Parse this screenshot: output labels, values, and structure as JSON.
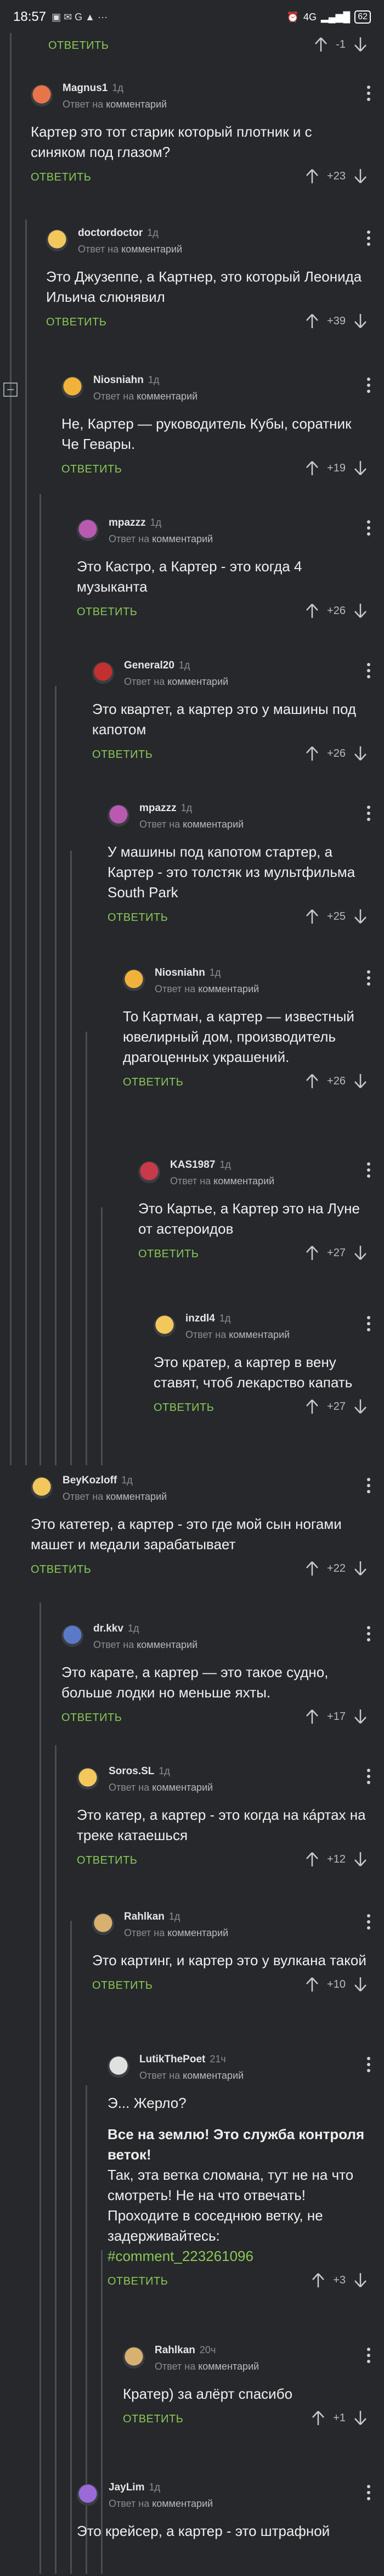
{
  "status_bar": {
    "time": "18:57",
    "network": "4G",
    "battery": "62"
  },
  "ui": {
    "reply": "ОТВЕТИТЬ",
    "reply_to_prefix": "Ответ на",
    "reply_to_target": "комментарий"
  },
  "top_partial": {
    "rating": "-1"
  },
  "comments": [
    {
      "author": "Magnus1",
      "time": "1д",
      "text": "Картер это тот старик который плотник и с синяком под глазом?",
      "rating": "+23",
      "avatar_color": "#e8744a"
    },
    {
      "author": "doctordoctor",
      "time": "1д",
      "text": "Это Джузеппе, а Картнер, это который Леонида Ильича слюнявил",
      "rating": "+39",
      "avatar_color": "#f2c75c"
    },
    {
      "author": "Niosniahn",
      "time": "1д",
      "text": "Не, Картер — руководитель Кубы, соратник Че Гевары.",
      "rating": "+19",
      "avatar_color": "#f0b23a"
    },
    {
      "author": "mpazzz",
      "time": "1д",
      "text": "Это Кастро, а Картер - это когда 4 музыканта",
      "rating": "+26",
      "avatar_color": "#b85ab0"
    },
    {
      "author": "General20",
      "time": "1д",
      "text": "Это квартет, а картер это у машины под капотом",
      "rating": "+26",
      "avatar_color": "#c23030"
    },
    {
      "author": "mpazzz",
      "time": "1д",
      "text": "У машины под капотом стартер, а Картер - это толстяк из мультфильма South Park",
      "rating": "+25",
      "avatar_color": "#b85ab0"
    },
    {
      "author": "Niosniahn",
      "time": "1д",
      "text": "То Картман, а картер — известный ювелирный дом, производитель драгоценных украшений.",
      "rating": "+26",
      "avatar_color": "#f0b23a"
    },
    {
      "author": "KAS1987",
      "time": "1д",
      "text": "Это Картье, а Картер это на Луне от астероидов",
      "rating": "+27",
      "avatar_color": "#c83a4a"
    },
    {
      "author": "inzdl4",
      "time": "1д",
      "text": "Это кратер, а картер в вену ставят, чтоб лекарство капать",
      "rating": "+27",
      "avatar_color": "#f2c75c"
    },
    {
      "author": "BeyKozloff",
      "time": "1д",
      "text": "Это катетер, а картер - это где мой сын ногами машет и медали зарабатывает",
      "rating": "+22",
      "avatar_color": "#f2c75c"
    },
    {
      "author": "dr.kkv",
      "time": "1д",
      "text": "Это карате, а картер — это такое судно, больше лодки но меньше яхты.",
      "rating": "+17",
      "avatar_color": "#5a7ac8"
    },
    {
      "author": "Soros.SL",
      "time": "1д",
      "text": "Это катер, а картер - это когда на кáртах на треке катаешься",
      "rating": "+12",
      "avatar_color": "#f2c75c"
    },
    {
      "author": "Rahlkan",
      "time": "1д",
      "text": "Это картинг, и картер это у вулкана такой",
      "rating": "+10",
      "avatar_color": "#d8b070"
    },
    {
      "author": "LutikThePoet",
      "time": "21ч",
      "text_lines": [
        "Э... Жерло?"
      ],
      "bold": "Все на землю! Это служба контроля веток!",
      "text2": "Так, эта ветка сломана, тут не на что смотреть! Не на что отвечать! Проходите в соседнюю ветку, не задерживайтесь:",
      "link": "#comment_223261096",
      "rating": "+3",
      "avatar_color": "#e0e0e0"
    },
    {
      "author": "Rahlkan",
      "time": "20ч",
      "text": "Кратер) за алёрт спасибо",
      "rating": "+1",
      "avatar_color": "#d8b070"
    },
    {
      "author": "JayLim",
      "time": "1д",
      "text": "Это крейсер, а картер - это штрафной",
      "avatar_color": "#9a6ad8"
    }
  ]
}
